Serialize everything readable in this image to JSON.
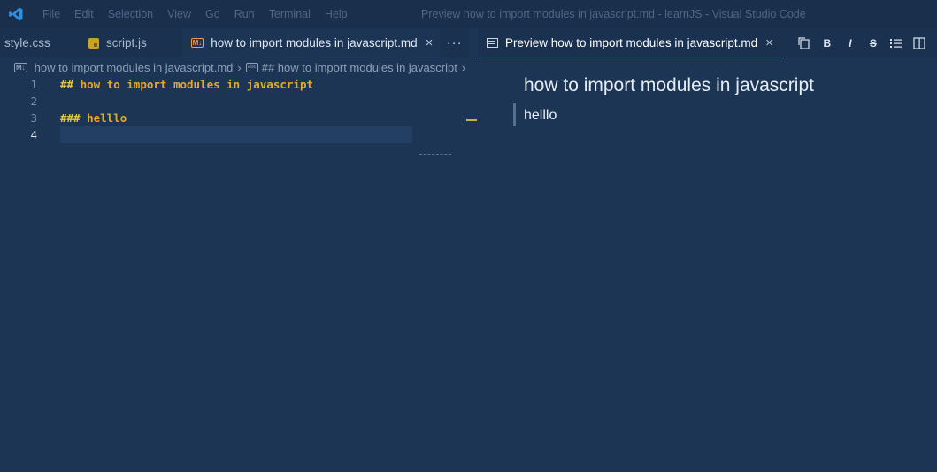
{
  "titlebar": {
    "menu": [
      "File",
      "Edit",
      "Selection",
      "View",
      "Go",
      "Run",
      "Terminal",
      "Help"
    ],
    "window_title": "Preview how to import modules in javascript.md - learnJS - Visual Studio Code"
  },
  "tabs_left": [
    {
      "label": "style.css"
    },
    {
      "label": "script.js"
    },
    {
      "label": "how to import modules in javascript.md",
      "close": "×"
    }
  ],
  "more_label": "···",
  "tab_preview": {
    "label": "Preview how to import modules in javascript.md",
    "close": "×"
  },
  "toolbar": {
    "bold": "B",
    "italic": "I",
    "strike": "S"
  },
  "breadcrumb": {
    "file": "how to import modules in javascript.md",
    "symbol": "## how to import modules in javascript"
  },
  "editor": {
    "lines": [
      {
        "num": "1",
        "hash": "##",
        "text": "how to import modules in javascript"
      },
      {
        "num": "2",
        "hash": "",
        "text": ""
      },
      {
        "num": "3",
        "hash": "###",
        "text": "helllo"
      },
      {
        "num": "4",
        "hash": "",
        "text": ""
      }
    ]
  },
  "preview": {
    "h2": "how to import modules in javascript",
    "h3": "helllo"
  },
  "colors": {
    "background": "#1d3555",
    "accent": "#e6c44a",
    "heading": "#e6a82b"
  }
}
